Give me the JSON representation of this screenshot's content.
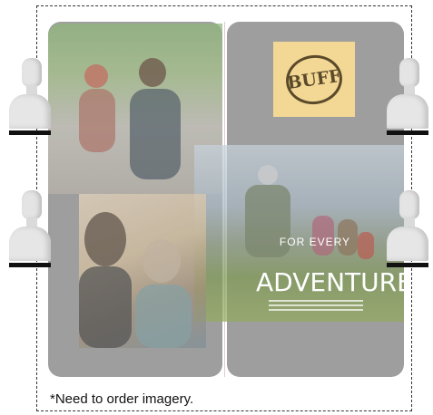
{
  "logo": {
    "text": "BUFF"
  },
  "ad": {
    "tagline": "FOR EVERY",
    "headline": "ADVENTURE"
  },
  "note": {
    "text": "*Need to order imagery."
  }
}
